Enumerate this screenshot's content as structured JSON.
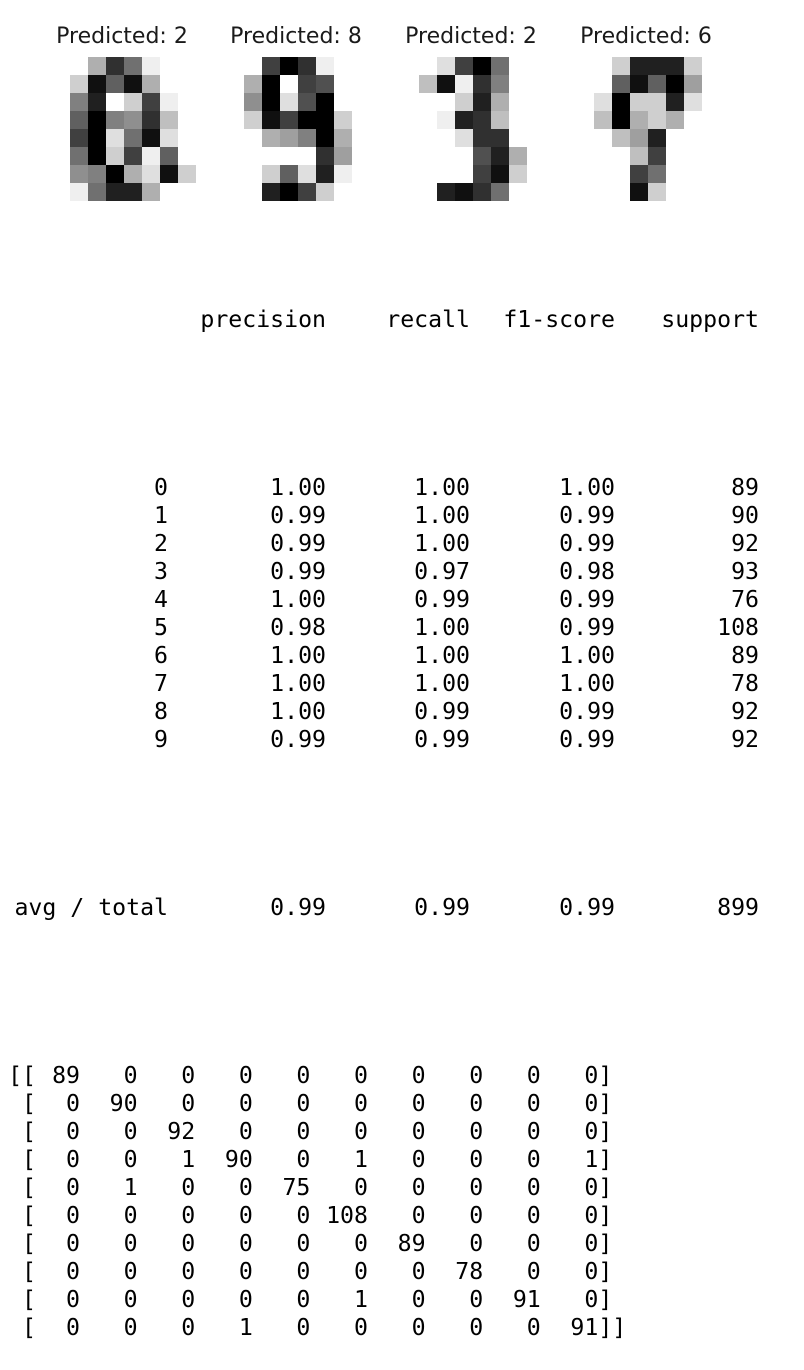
{
  "digits": [
    {
      "title": "Predicted: 2",
      "pixels": [
        [
          0,
          0,
          5,
          13,
          9,
          1,
          0,
          0
        ],
        [
          0,
          3,
          15,
          10,
          15,
          5,
          0,
          0
        ],
        [
          0,
          8,
          14,
          0,
          3,
          12,
          1,
          0
        ],
        [
          0,
          10,
          16,
          8,
          7,
          13,
          4,
          0
        ],
        [
          0,
          12,
          16,
          2,
          9,
          15,
          2,
          0
        ],
        [
          0,
          9,
          16,
          3,
          12,
          1,
          10,
          0
        ],
        [
          0,
          7,
          8,
          16,
          5,
          2,
          15,
          3
        ],
        [
          0,
          1,
          9,
          14,
          14,
          5,
          0,
          0
        ]
      ]
    },
    {
      "title": "Predicted: 8",
      "pixels": [
        [
          0,
          0,
          12,
          16,
          13,
          1,
          0,
          0
        ],
        [
          0,
          5,
          16,
          0,
          12,
          11,
          0,
          0
        ],
        [
          0,
          7,
          16,
          2,
          11,
          16,
          0,
          0
        ],
        [
          0,
          3,
          15,
          12,
          16,
          16,
          3,
          0
        ],
        [
          0,
          0,
          5,
          6,
          8,
          16,
          5,
          0
        ],
        [
          0,
          0,
          0,
          0,
          0,
          13,
          6,
          0
        ],
        [
          0,
          0,
          3,
          10,
          2,
          14,
          1,
          0
        ],
        [
          0,
          0,
          14,
          16,
          12,
          3,
          0,
          0
        ]
      ]
    },
    {
      "title": "Predicted: 2",
      "pixels": [
        [
          0,
          0,
          2,
          12,
          16,
          9,
          0,
          0
        ],
        [
          0,
          4,
          15,
          1,
          13,
          8,
          0,
          0
        ],
        [
          0,
          0,
          0,
          3,
          14,
          5,
          0,
          0
        ],
        [
          0,
          0,
          1,
          14,
          13,
          4,
          0,
          0
        ],
        [
          0,
          0,
          0,
          2,
          13,
          13,
          0,
          0
        ],
        [
          0,
          0,
          0,
          0,
          11,
          14,
          5,
          0
        ],
        [
          0,
          0,
          0,
          0,
          12,
          15,
          3,
          0
        ],
        [
          0,
          0,
          14,
          15,
          13,
          9,
          0,
          0
        ]
      ]
    },
    {
      "title": "Predicted: 6",
      "pixels": [
        [
          0,
          0,
          3,
          14,
          14,
          14,
          3,
          0
        ],
        [
          0,
          0,
          10,
          15,
          10,
          16,
          6,
          0
        ],
        [
          0,
          2,
          16,
          3,
          3,
          14,
          2,
          0
        ],
        [
          0,
          4,
          16,
          5,
          3,
          5,
          0,
          0
        ],
        [
          0,
          0,
          4,
          6,
          14,
          0,
          0,
          0
        ],
        [
          0,
          0,
          0,
          4,
          12,
          0,
          0,
          0
        ],
        [
          0,
          0,
          0,
          12,
          9,
          0,
          0,
          0
        ],
        [
          0,
          0,
          0,
          15,
          3,
          0,
          0,
          0
        ]
      ]
    }
  ],
  "report": {
    "header": [
      "precision",
      "recall",
      "f1-score",
      "support"
    ],
    "rows": [
      {
        "label": "0",
        "precision": "1.00",
        "recall": "1.00",
        "f1": "1.00",
        "support": "89"
      },
      {
        "label": "1",
        "precision": "0.99",
        "recall": "1.00",
        "f1": "0.99",
        "support": "90"
      },
      {
        "label": "2",
        "precision": "0.99",
        "recall": "1.00",
        "f1": "0.99",
        "support": "92"
      },
      {
        "label": "3",
        "precision": "0.99",
        "recall": "0.97",
        "f1": "0.98",
        "support": "93"
      },
      {
        "label": "4",
        "precision": "1.00",
        "recall": "0.99",
        "f1": "0.99",
        "support": "76"
      },
      {
        "label": "5",
        "precision": "0.98",
        "recall": "1.00",
        "f1": "0.99",
        "support": "108"
      },
      {
        "label": "6",
        "precision": "1.00",
        "recall": "1.00",
        "f1": "1.00",
        "support": "89"
      },
      {
        "label": "7",
        "precision": "1.00",
        "recall": "1.00",
        "f1": "1.00",
        "support": "78"
      },
      {
        "label": "8",
        "precision": "1.00",
        "recall": "0.99",
        "f1": "0.99",
        "support": "92"
      },
      {
        "label": "9",
        "precision": "0.99",
        "recall": "0.99",
        "f1": "0.99",
        "support": "92"
      }
    ],
    "total": {
      "label": "avg / total",
      "precision": "0.99",
      "recall": "0.99",
      "f1": "0.99",
      "support": "899"
    }
  },
  "confusion_matrix": [
    [
      89,
      0,
      0,
      0,
      0,
      0,
      0,
      0,
      0,
      0
    ],
    [
      0,
      90,
      0,
      0,
      0,
      0,
      0,
      0,
      0,
      0
    ],
    [
      0,
      0,
      92,
      0,
      0,
      0,
      0,
      0,
      0,
      0
    ],
    [
      0,
      0,
      1,
      90,
      0,
      1,
      0,
      0,
      0,
      1
    ],
    [
      0,
      1,
      0,
      0,
      75,
      0,
      0,
      0,
      0,
      0
    ],
    [
      0,
      0,
      0,
      0,
      0,
      108,
      0,
      0,
      0,
      0
    ],
    [
      0,
      0,
      0,
      0,
      0,
      0,
      89,
      0,
      0,
      0
    ],
    [
      0,
      0,
      0,
      0,
      0,
      0,
      0,
      78,
      0,
      0
    ],
    [
      0,
      0,
      0,
      0,
      0,
      1,
      0,
      0,
      91,
      0
    ],
    [
      0,
      0,
      0,
      1,
      0,
      0,
      0,
      0,
      0,
      91
    ]
  ]
}
